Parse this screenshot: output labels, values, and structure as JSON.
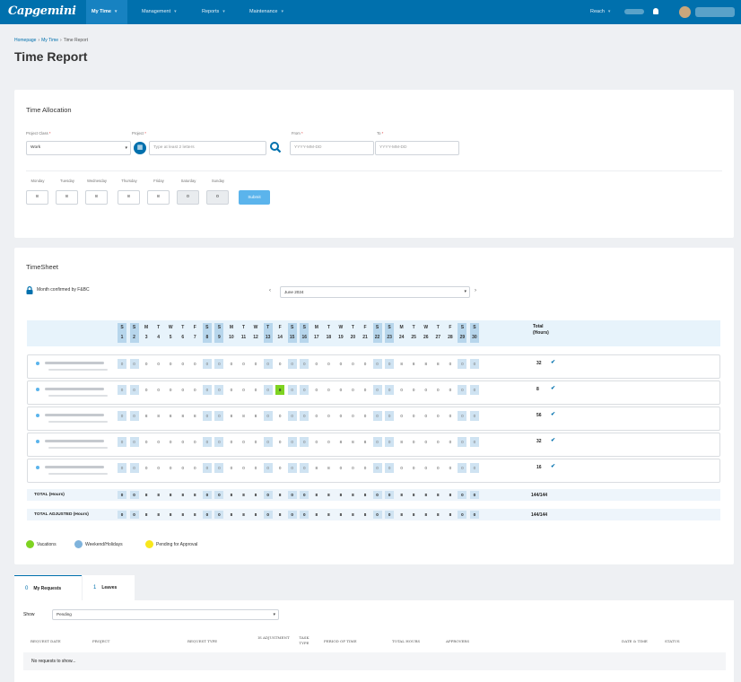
{
  "header": {
    "logo": "Capgemini",
    "nav": [
      {
        "label": "My Time",
        "active": true
      },
      {
        "label": "Management"
      },
      {
        "label": "Reports"
      },
      {
        "label": "Maintenance"
      }
    ],
    "reach_label": "Reach"
  },
  "breadcrumb": [
    "Homepage",
    "My Time",
    "Time Report"
  ],
  "page_title": "Time Report",
  "allocation": {
    "title": "Time Allocation",
    "project_class_label": "Project Class",
    "project_class_value": "Work",
    "project_label": "Project",
    "project_placeholder": "Type at least 2 letters",
    "from_label": "From",
    "from_placeholder": "YYYY-MM-DD",
    "to_label": "To",
    "to_placeholder": "YYYY-MM-DD",
    "days": [
      {
        "label": "Monday",
        "value": "8"
      },
      {
        "label": "Tuesday",
        "value": "8"
      },
      {
        "label": "Wednesday",
        "value": "8"
      },
      {
        "label": "Thursday",
        "value": "8"
      },
      {
        "label": "Friday",
        "value": "8"
      },
      {
        "label": "Saturday",
        "value": "0"
      },
      {
        "label": "Sunday",
        "value": "0"
      }
    ],
    "submit_label": "Submit"
  },
  "timesheet": {
    "title": "TimeSheet",
    "lock_text": "Month confirmed by F&BC",
    "month": "June 2024",
    "day_letters": [
      "S",
      "S",
      "M",
      "T",
      "W",
      "T",
      "F",
      "S",
      "S",
      "M",
      "T",
      "W",
      "T",
      "F",
      "S",
      "S",
      "M",
      "T",
      "W",
      "T",
      "F",
      "S",
      "S",
      "M",
      "T",
      "W",
      "T",
      "F",
      "S",
      "S"
    ],
    "day_numbers": [
      "1",
      "2",
      "3",
      "4",
      "5",
      "6",
      "7",
      "8",
      "9",
      "10",
      "11",
      "12",
      "13",
      "14",
      "15",
      "16",
      "17",
      "18",
      "19",
      "20",
      "21",
      "22",
      "23",
      "24",
      "25",
      "26",
      "27",
      "28",
      "29",
      "30"
    ],
    "weekend_idx": [
      0,
      1,
      7,
      8,
      12,
      14,
      15,
      21,
      22,
      28,
      29
    ],
    "total_header": "Total",
    "total_header_unit": "(Hours)",
    "rows": [
      {
        "values": [
          "0",
          "0",
          "0",
          "0",
          "0",
          "0",
          "0",
          "0",
          "0",
          "0",
          "0",
          "0",
          "0",
          "0",
          "0",
          "0",
          "0",
          "0",
          "0",
          "0",
          "0",
          "0",
          "0",
          "8",
          "8",
          "8",
          "8",
          "0",
          "0",
          "0"
        ],
        "total": "32",
        "vac": -1
      },
      {
        "values": [
          "0",
          "0",
          "0",
          "0",
          "0",
          "0",
          "0",
          "0",
          "0",
          "0",
          "0",
          "0",
          "0",
          "8",
          "0",
          "0",
          "0",
          "0",
          "0",
          "0",
          "0",
          "0",
          "0",
          "0",
          "0",
          "0",
          "0",
          "0",
          "0",
          "0"
        ],
        "total": "8",
        "vac": 13
      },
      {
        "values": [
          "0",
          "0",
          "8",
          "8",
          "8",
          "8",
          "8",
          "0",
          "0",
          "8",
          "8",
          "8",
          "0",
          "0",
          "0",
          "0",
          "0",
          "0",
          "0",
          "0",
          "0",
          "0",
          "0",
          "0",
          "0",
          "0",
          "0",
          "0",
          "0",
          "0"
        ],
        "total": "56",
        "vac": -1
      },
      {
        "values": [
          "0",
          "0",
          "0",
          "0",
          "0",
          "0",
          "0",
          "0",
          "0",
          "0",
          "0",
          "0",
          "0",
          "0",
          "0",
          "0",
          "0",
          "0",
          "8",
          "8",
          "8",
          "0",
          "0",
          "8",
          "0",
          "0",
          "0",
          "0",
          "0",
          "0"
        ],
        "total": "32",
        "vac": -1
      },
      {
        "values": [
          "0",
          "0",
          "0",
          "0",
          "0",
          "0",
          "0",
          "0",
          "0",
          "0",
          "0",
          "0",
          "0",
          "0",
          "0",
          "0",
          "8",
          "8",
          "0",
          "0",
          "0",
          "0",
          "0",
          "0",
          "0",
          "0",
          "0",
          "0",
          "0",
          "0"
        ],
        "total": "16",
        "vac": -1
      }
    ],
    "total_label": "TOTAL (Hours)",
    "total_values": [
      "0",
      "0",
      "8",
      "8",
      "8",
      "8",
      "8",
      "0",
      "0",
      "8",
      "8",
      "8",
      "0",
      "8",
      "0",
      "0",
      "8",
      "8",
      "8",
      "8",
      "8",
      "0",
      "0",
      "8",
      "8",
      "8",
      "8",
      "8",
      "0",
      "0"
    ],
    "total_sum": "144/144",
    "adjusted_label": "TOTAL ADJUSTED (Hours)",
    "adjusted_values": [
      "0",
      "0",
      "8",
      "8",
      "8",
      "8",
      "8",
      "0",
      "0",
      "8",
      "8",
      "8",
      "0",
      "8",
      "0",
      "0",
      "8",
      "8",
      "8",
      "8",
      "8",
      "0",
      "0",
      "8",
      "8",
      "8",
      "8",
      "8",
      "0",
      "0"
    ],
    "adjusted_sum": "144/144",
    "legend": [
      {
        "label": "Vacations",
        "color": "#7ed321"
      },
      {
        "label": "Weekend/Holidays",
        "color": "#7fb3dc"
      },
      {
        "label": "Pending for Approval",
        "color": "#f8e71c"
      }
    ]
  },
  "requests": {
    "tabs": [
      {
        "count": "0",
        "label": "My Requests"
      },
      {
        "count": "1",
        "label": "Leaves"
      }
    ],
    "show_label": "Show",
    "show_value": "Pending",
    "columns": [
      "Request Date",
      "Project",
      "Request Type",
      "Is Adjustment",
      "Task Type",
      "Period of Time",
      "Total Hours",
      "Approvers",
      "Date & Time",
      "Status"
    ],
    "empty_text": "No requests to show..."
  }
}
